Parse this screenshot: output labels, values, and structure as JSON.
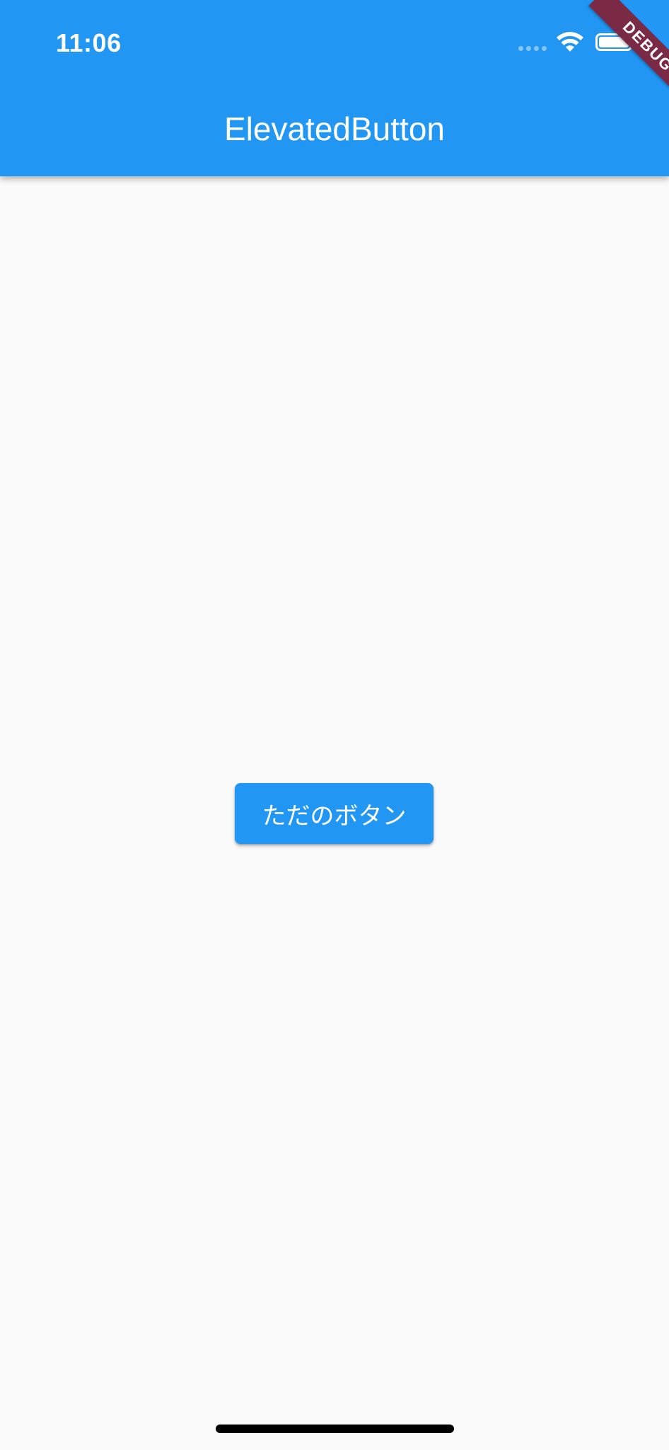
{
  "status_bar": {
    "time": "11:06"
  },
  "app_bar": {
    "title": "ElevatedButton"
  },
  "debug_banner": {
    "label": "DEBUG"
  },
  "main": {
    "button_label": "ただのボタン"
  },
  "colors": {
    "primary": "#2196f3",
    "background": "#fafafa",
    "debug_banner": "#7a2a45"
  },
  "icons": {
    "wifi": "wifi-icon",
    "battery": "battery-icon",
    "signal": "cellular-signal-icon"
  }
}
